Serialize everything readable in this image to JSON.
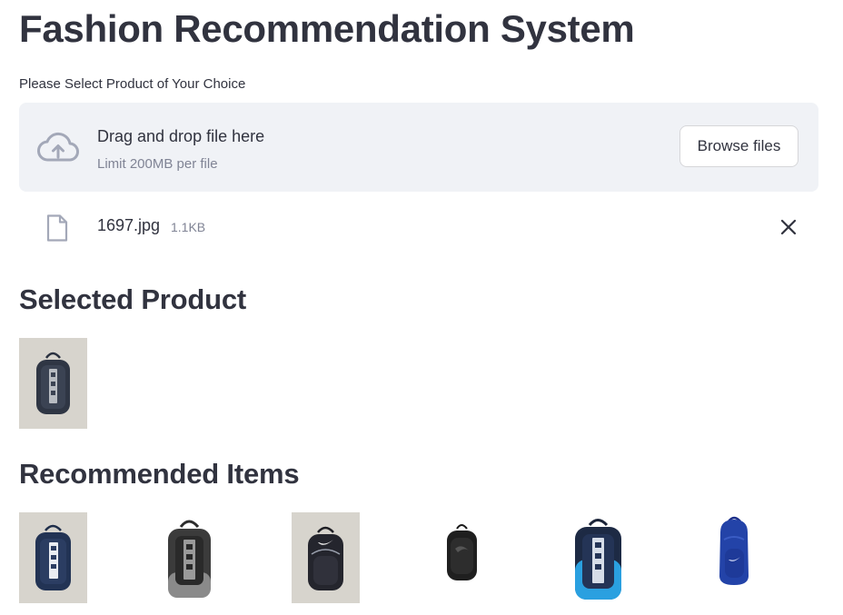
{
  "page": {
    "title": "Fashion Recommendation System"
  },
  "uploader": {
    "label": "Please Select Product of Your Choice",
    "drop_title": "Drag and drop file here",
    "limit_text": "Limit 200MB per file",
    "browse_label": "Browse files",
    "icon": "cloud-upload-icon"
  },
  "uploaded_file": {
    "name": "1697.jpg",
    "size": "1.1KB",
    "icon": "file-icon",
    "remove_icon": "close-icon"
  },
  "selected": {
    "heading": "Selected Product",
    "image": "puma-backpack-navy"
  },
  "recommended": {
    "heading": "Recommended Items",
    "items": [
      "puma-backpack-navy",
      "puma-backpack-grey",
      "nike-backpack-black",
      "puma-backpack-black",
      "puma-backpack-blue",
      "nike-backpack-royal-blue"
    ]
  },
  "colors": {
    "text": "#31333f",
    "muted": "#808495",
    "dropzone_bg": "#f0f2f6",
    "border": "#d6d6d9"
  }
}
